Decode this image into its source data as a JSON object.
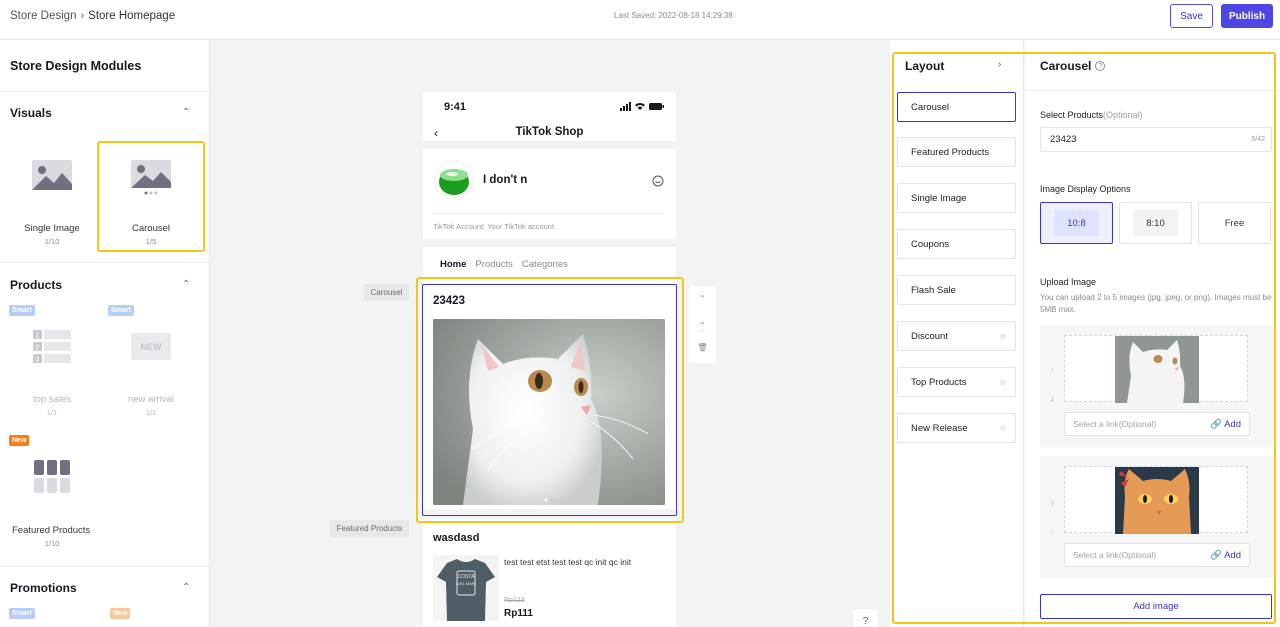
{
  "topbar": {
    "breadcrumb_root": "Store Design",
    "breadcrumb_current": "Store Homepage",
    "last_saved": "Last Saved: 2022-08-18 14:29:38",
    "save_label": "Save",
    "publish_label": "Publish"
  },
  "sidebar": {
    "title": "Store Design Modules",
    "visuals": {
      "title": "Visuals",
      "items": [
        {
          "name": "Single Image",
          "count": "1/10"
        },
        {
          "name": "Carousel",
          "count": "1/5"
        }
      ]
    },
    "products": {
      "title": "Products",
      "items": [
        {
          "name": "top sales",
          "count": "1/1",
          "tag": "Smart"
        },
        {
          "name": "new arrival",
          "count": "1/1",
          "tag": "Smart",
          "thumb_text": "NEW"
        },
        {
          "name": "Featured Products",
          "count": "1/10",
          "tag": "New"
        }
      ],
      "rank_numbers": [
        "1",
        "2",
        "3"
      ]
    },
    "promotions": {
      "title": "Promotions",
      "tags": [
        "Smart",
        "New"
      ]
    }
  },
  "canvas": {
    "carousel_label": "Carousel",
    "featured_label": "Featured Products",
    "phone": {
      "time": "9:41",
      "shop_title": "TikTok Shop",
      "shop_name": "I don't n",
      "account": "TikTok Account: Your TikTok account",
      "tabs": [
        "Home",
        "Products",
        "Categories"
      ],
      "carousel_title": "23423",
      "featured_title": "wasdasd",
      "product_desc": "test test etst test test qc init qc init",
      "price_old": "Rp123",
      "price": "Rp111",
      "shirt_text_1": "COSTA",
      "shirt_text_2": "DEL MAR"
    }
  },
  "layout": {
    "title": "Layout",
    "items": [
      {
        "label": "Carousel",
        "active": true,
        "hidden": false
      },
      {
        "label": "Featured Products",
        "active": false,
        "hidden": false
      },
      {
        "label": "Single Image",
        "active": false,
        "hidden": false
      },
      {
        "label": "Coupons",
        "active": false,
        "hidden": false
      },
      {
        "label": "Flash Sale",
        "active": false,
        "hidden": false
      },
      {
        "label": "Discount",
        "active": false,
        "hidden": true
      },
      {
        "label": "Top Products",
        "active": false,
        "hidden": true
      },
      {
        "label": "New Release",
        "active": false,
        "hidden": true
      }
    ]
  },
  "panel": {
    "title": "Carousel",
    "select_products_label": "Select Products",
    "select_products_optional": "(Optional)",
    "select_products_value": "23423",
    "select_products_count": "5/42",
    "display_options_label": "Image Display Options",
    "display_options": [
      "10:8",
      "8:10",
      "Free"
    ],
    "display_selected": "10:8",
    "upload_label": "Upload Image",
    "upload_hint": "You can upload 2 to 5 images (jpg, jpeg, or png). Images must be 5MB max.",
    "link_placeholder": "Select a link(Optional)",
    "link_add": "Add",
    "add_image": "Add image"
  },
  "colors": {
    "accent": "#4f46e5",
    "highlight": "#f5c518"
  }
}
